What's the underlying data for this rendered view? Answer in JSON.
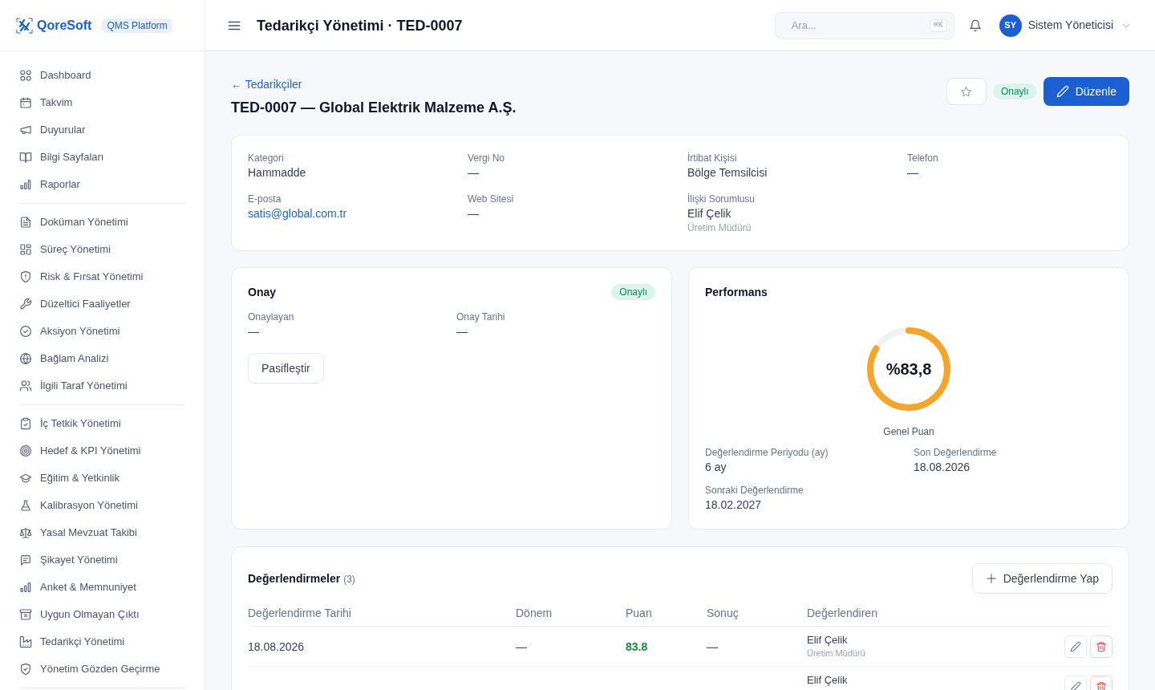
{
  "brand": {
    "name": "QoreSoft",
    "badge": "QMS Platform"
  },
  "sidebar": {
    "groups": [
      {
        "items": [
          {
            "label": "Dashboard"
          },
          {
            "label": "Takvim"
          },
          {
            "label": "Duyurular"
          },
          {
            "label": "Bilgi Sayfaları"
          },
          {
            "label": "Raporlar"
          }
        ]
      },
      {
        "items": [
          {
            "label": "Doküman Yönetimi"
          },
          {
            "label": "Süreç Yönetimi"
          },
          {
            "label": "Risk & Fırsat Yönetimi"
          },
          {
            "label": "Düzeltici Faaliyetler"
          },
          {
            "label": "Aksiyon Yönetimi"
          },
          {
            "label": "Bağlam Analizi"
          },
          {
            "label": "İlgili Taraf Yönetimi"
          }
        ]
      },
      {
        "items": [
          {
            "label": "İç Tetkik Yönetimi"
          },
          {
            "label": "Hedef & KPI Yönetimi"
          },
          {
            "label": "Eğitim & Yetkinlik"
          },
          {
            "label": "Kalibrasyon Yönetimi"
          },
          {
            "label": "Yasal Mevzuat Takibi"
          },
          {
            "label": "Şikayet Yönetimi"
          },
          {
            "label": "Anket & Memnuniyet"
          },
          {
            "label": "Uygun Olmayan Çıktı"
          },
          {
            "label": "Tedarikçi Yönetimi"
          },
          {
            "label": "Yönetim Gözden Geçirme"
          }
        ]
      }
    ]
  },
  "header": {
    "title": "Tedarikçi Yönetimi · TED-0007",
    "search": {
      "placeholder": "Ara...",
      "shortcut": "⌘K"
    },
    "user": {
      "initials": "SY",
      "name": "Sistem Yöneticisi"
    }
  },
  "page": {
    "back_link": "← Tedarikçiler",
    "title": "TED-0007 — Global Elektrik Malzeme A.Ş.",
    "status": "Onaylı",
    "edit_button": "Düzenle"
  },
  "info": {
    "fields": [
      {
        "kind": "text",
        "label": "Kategori",
        "value": "Hammadde"
      },
      {
        "kind": "text",
        "label": "Vergi No",
        "value": "—"
      },
      {
        "kind": "text",
        "label": "İrtibat Kişisi",
        "value": "Bölge Temsilcisi"
      },
      {
        "kind": "text",
        "label": "Telefon",
        "value": "—"
      },
      {
        "kind": "link",
        "label": "E-posta",
        "value": "satis@global.com.tr"
      },
      {
        "kind": "text",
        "label": "Web Sitesi",
        "value": "—"
      },
      {
        "kind": "person",
        "label": "İlişki Sorumlusu",
        "value": "Elif Çelik",
        "note": "Üretim Müdürü"
      }
    ]
  },
  "approval": {
    "title": "Onay",
    "status": "Onaylı",
    "fields": [
      {
        "label": "Onaylayan",
        "value": "—"
      },
      {
        "label": "Onay Tarihi",
        "value": "—"
      }
    ],
    "button": "Pasifleştir"
  },
  "performance": {
    "title": "Performans",
    "score": {
      "reading": "%83,8",
      "level": 0.838,
      "caption": "Genel Puan"
    },
    "fields": [
      {
        "label": "Değerlendirme Periyodu (ay)",
        "value": "6 ay"
      },
      {
        "label": "Son Değerlendirme",
        "value": "18.08.2026"
      },
      {
        "label": "Sonraki Değerlendirme",
        "value": "18.02.2027"
      }
    ]
  },
  "evaluations": {
    "title": "Değerlendirmeler",
    "count": "(3)",
    "add_button": "Değerlendirme Yap",
    "columns": [
      "Değerlendirme Tarihi",
      "Dönem",
      "Puan",
      "Sonuç",
      "Değerlendiren"
    ],
    "rows": [
      {
        "date": "18.08.2026",
        "period": "—",
        "score": "83.8",
        "result": "—",
        "evaluator": "Elif Çelik",
        "evaluator_role": "Üretim Müdürü"
      },
      {
        "evaluator": "Elif Çelik"
      }
    ]
  }
}
